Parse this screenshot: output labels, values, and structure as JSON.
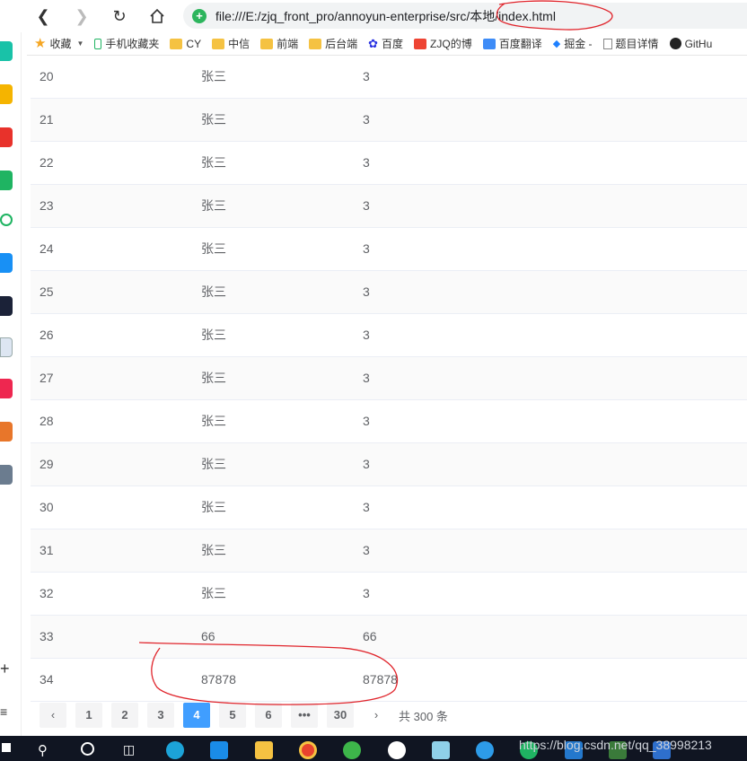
{
  "browser": {
    "url": "file:///E:/zjq_front_pro/annoyun-enterprise/src/本地/index.html"
  },
  "bookmarks": [
    {
      "label": "收藏",
      "icon": "star-icon"
    },
    {
      "label": "手机收藏夹",
      "icon": "phone-icon"
    },
    {
      "label": "CY",
      "icon": "folder-icon"
    },
    {
      "label": "中信",
      "icon": "folder-icon"
    },
    {
      "label": "前端",
      "icon": "folder-icon"
    },
    {
      "label": "后台端",
      "icon": "folder-icon"
    },
    {
      "label": "百度",
      "icon": "baidu-icon"
    },
    {
      "label": "ZJQ的博",
      "icon": "csdn-icon"
    },
    {
      "label": "百度翻译",
      "icon": "translate-icon"
    },
    {
      "label": "掘金 -",
      "icon": "juejin-icon"
    },
    {
      "label": "题目详情",
      "icon": "document-icon"
    },
    {
      "label": "GitHu",
      "icon": "github-icon"
    }
  ],
  "table": {
    "rows": [
      {
        "id": "20",
        "name": "张三",
        "value": "3"
      },
      {
        "id": "21",
        "name": "张三",
        "value": "3"
      },
      {
        "id": "22",
        "name": "张三",
        "value": "3"
      },
      {
        "id": "23",
        "name": "张三",
        "value": "3"
      },
      {
        "id": "24",
        "name": "张三",
        "value": "3"
      },
      {
        "id": "25",
        "name": "张三",
        "value": "3"
      },
      {
        "id": "26",
        "name": "张三",
        "value": "3"
      },
      {
        "id": "27",
        "name": "张三",
        "value": "3"
      },
      {
        "id": "28",
        "name": "张三",
        "value": "3"
      },
      {
        "id": "29",
        "name": "张三",
        "value": "3"
      },
      {
        "id": "30",
        "name": "张三",
        "value": "3"
      },
      {
        "id": "31",
        "name": "张三",
        "value": "3"
      },
      {
        "id": "32",
        "name": "张三",
        "value": "3"
      },
      {
        "id": "33",
        "name": "66",
        "value": "66"
      },
      {
        "id": "34",
        "name": "87878",
        "value": "87878"
      }
    ]
  },
  "pagination": {
    "prev": "‹",
    "pages": [
      "1",
      "2",
      "3",
      "4",
      "5",
      "6",
      "•••",
      "30"
    ],
    "active": "4",
    "next": "›",
    "total": "共 300 条"
  },
  "watermark": "https://blog.csdn.net/qq_38998213",
  "colors": {
    "active_page": "#409eff",
    "annotation": "#e0242b",
    "stripe": "#fafafa"
  }
}
